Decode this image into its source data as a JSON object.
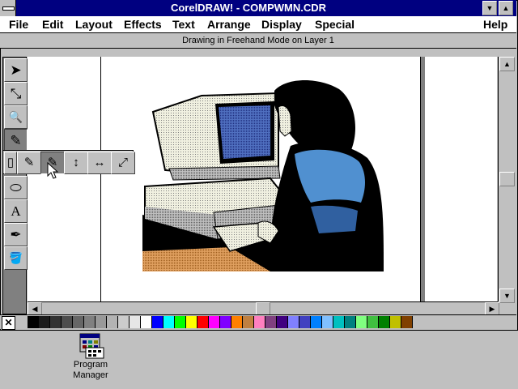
{
  "window": {
    "title": "CorelDRAW! - COMPWMN.CDR",
    "min_glyph": "▼",
    "max_glyph": "▲"
  },
  "menu": {
    "file": "File",
    "edit": "Edit",
    "layout": "Layout",
    "effects": "Effects",
    "text": "Text",
    "arrange": "Arrange",
    "display": "Display",
    "special": "Special",
    "help": "Help"
  },
  "status": "Drawing in Freehand Mode on Layer 1",
  "toolbox": {
    "icons": [
      "pick-tool-icon",
      "shape-tool-icon",
      "zoom-tool-icon",
      "pencil-tool-icon",
      "rectangle-tool-icon",
      "ellipse-tool-icon",
      "text-tool-icon",
      "outline-pen-tool-icon",
      "fill-tool-icon"
    ],
    "pick": "➤",
    "shape": "⤡",
    "zoom": "🔍",
    "pencil": "✎",
    "ellipse": "⬭",
    "text": "A",
    "outline": "✒",
    "fill": "🪣"
  },
  "flyout": {
    "rect": "▯",
    "freehand": "✎",
    "bezier": "✎",
    "vdim": "↕",
    "hdim": "↔",
    "ddim": "⤢"
  },
  "palette": {
    "no_fill": "✕",
    "colors": [
      "#000000",
      "#1a1a1a",
      "#333333",
      "#4d4d4d",
      "#666666",
      "#808080",
      "#999999",
      "#b3b3b3",
      "#cccccc",
      "#e6e6e6",
      "#ffffff",
      "#0000ff",
      "#00ffff",
      "#00ff00",
      "#ffff00",
      "#ff0000",
      "#ff00ff",
      "#8000ff",
      "#ff8000",
      "#c08040",
      "#ff80c0",
      "#804080",
      "#400080",
      "#8080ff",
      "#4040c0",
      "#0080ff",
      "#80c0ff",
      "#00c0c0",
      "#008080",
      "#80ff80",
      "#40c040",
      "#008000",
      "#c0c000",
      "#804000"
    ]
  },
  "desktop": {
    "program_manager_line1": "Program",
    "program_manager_line2": "Manager"
  }
}
